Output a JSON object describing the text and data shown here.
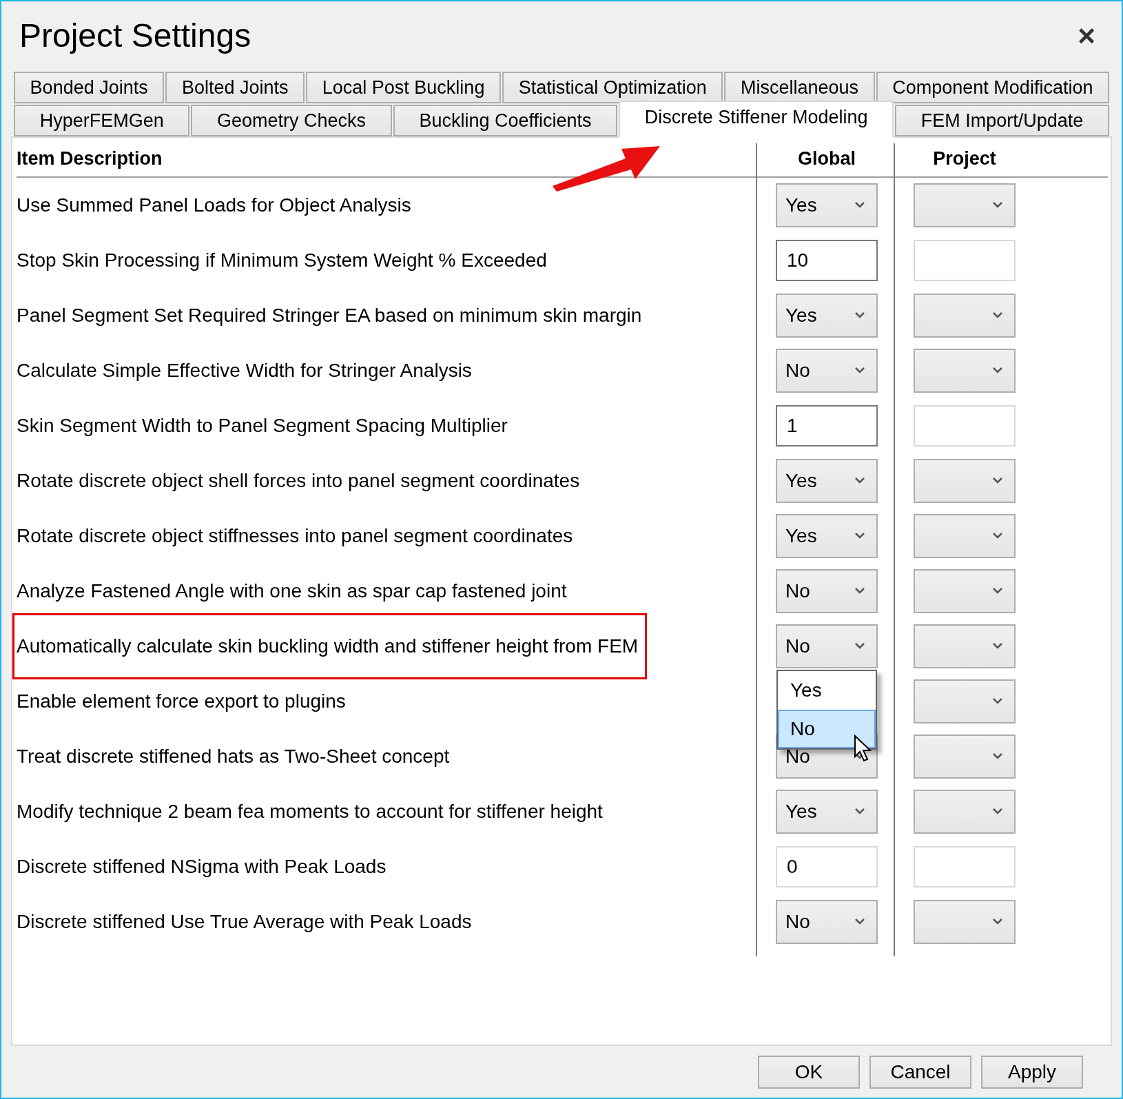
{
  "window": {
    "title": "Project Settings",
    "close": "×"
  },
  "tab_rows": [
    [
      {
        "label": "Bonded Joints",
        "selected": false
      },
      {
        "label": "Bolted Joints",
        "selected": false
      },
      {
        "label": "Local Post Buckling",
        "selected": false
      },
      {
        "label": "Statistical Optimization",
        "selected": false
      },
      {
        "label": "Miscellaneous",
        "selected": false
      },
      {
        "label": "Component Modification",
        "selected": false
      }
    ],
    [
      {
        "label": "HyperFEMGen",
        "selected": false
      },
      {
        "label": "Geometry Checks",
        "selected": false
      },
      {
        "label": "Buckling Coefficients",
        "selected": false
      },
      {
        "label": "Discrete Stiffener Modeling",
        "selected": true
      },
      {
        "label": "FEM Import/Update",
        "selected": false
      }
    ]
  ],
  "table": {
    "columns": [
      "Item Description",
      "Global",
      "Project"
    ],
    "rows": [
      {
        "description": "Use Summed Panel Loads for Object Analysis",
        "highlighted": false,
        "global": {
          "kind": "select",
          "value": "Yes"
        },
        "project": {
          "kind": "select"
        }
      },
      {
        "description": "Stop Skin Processing if Minimum System Weight % Exceeded",
        "highlighted": false,
        "global": {
          "kind": "text",
          "value": "10",
          "disabled": false
        },
        "project": {
          "kind": "text",
          "disabled": true
        }
      },
      {
        "description": "Panel Segment Set Required Stringer EA based on minimum skin margin",
        "highlighted": false,
        "global": {
          "kind": "select",
          "value": "Yes"
        },
        "project": {
          "kind": "select"
        }
      },
      {
        "description": "Calculate Simple Effective Width for Stringer Analysis",
        "highlighted": false,
        "global": {
          "kind": "select",
          "value": "No"
        },
        "project": {
          "kind": "select"
        }
      },
      {
        "description": "Skin Segment Width to Panel Segment Spacing Multiplier",
        "highlighted": false,
        "global": {
          "kind": "text",
          "value": "1",
          "disabled": false
        },
        "project": {
          "kind": "text",
          "disabled": true
        }
      },
      {
        "description": "Rotate discrete object shell forces into panel segment coordinates",
        "highlighted": false,
        "global": {
          "kind": "select",
          "value": "Yes"
        },
        "project": {
          "kind": "select"
        }
      },
      {
        "description": "Rotate discrete object stiffnesses into panel segment coordinates",
        "highlighted": false,
        "global": {
          "kind": "select",
          "value": "Yes"
        },
        "project": {
          "kind": "select"
        }
      },
      {
        "description": "Analyze Fastened Angle with one skin as spar cap fastened joint",
        "highlighted": false,
        "global": {
          "kind": "select",
          "value": "No"
        },
        "project": {
          "kind": "select"
        }
      },
      {
        "description": "Automatically calculate skin buckling width and stiffener height from FEM",
        "highlighted": true,
        "global": {
          "kind": "select",
          "value": "No",
          "open": true,
          "options": [
            {
              "label": "Yes",
              "selected": false
            },
            {
              "label": "No",
              "selected": true
            }
          ]
        },
        "project": {
          "kind": "select"
        }
      },
      {
        "description": "Enable element force export to plugins",
        "highlighted": false,
        "global": {
          "kind": "covered"
        },
        "project": {
          "kind": "select"
        }
      },
      {
        "description": "Treat discrete stiffened hats as Two-Sheet concept",
        "highlighted": false,
        "global": {
          "kind": "select",
          "value": "No"
        },
        "project": {
          "kind": "select"
        }
      },
      {
        "description": "Modify technique 2 beam fea moments to account for stiffener height",
        "highlighted": false,
        "global": {
          "kind": "select",
          "value": "Yes"
        },
        "project": {
          "kind": "select"
        }
      },
      {
        "description": "Discrete stiffened NSigma with Peak Loads",
        "highlighted": false,
        "global": {
          "kind": "text",
          "value": "0",
          "disabled": true
        },
        "project": {
          "kind": "text",
          "disabled": true
        }
      },
      {
        "description": "Discrete stiffened Use True Average with Peak Loads",
        "highlighted": false,
        "global": {
          "kind": "select",
          "value": "No"
        },
        "project": {
          "kind": "select"
        }
      }
    ]
  },
  "buttons": [
    "OK",
    "Cancel",
    "Apply"
  ]
}
